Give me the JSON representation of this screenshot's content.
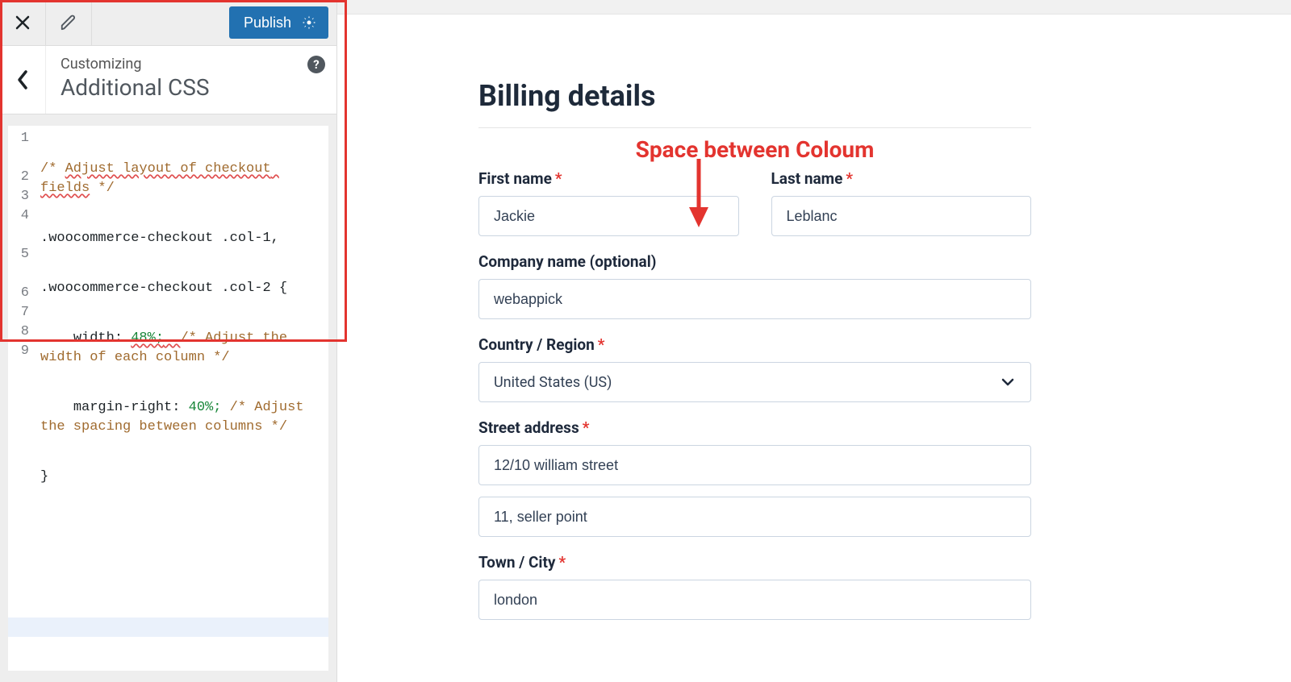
{
  "customizer": {
    "close_title": "Close",
    "brush_title": "Edit",
    "publish_label": "Publish",
    "gear_title": "Publish settings",
    "back_title": "Back",
    "breadcrumb": "Customizing",
    "section_title": "Additional CSS",
    "help_title": "Help"
  },
  "editor": {
    "line_numbers": [
      "1",
      "2",
      "3",
      "4",
      "5",
      "6",
      "7",
      "8",
      "9"
    ],
    "code": {
      "l1a": "/* ",
      "l1b": "Adjust layout of checkout fields",
      "l1c": " */",
      "l2": ".woocommerce-checkout .col-1,",
      "l3": ".woocommerce-checkout .col-2 {",
      "l4_prop": "width: ",
      "l4_val": "48%;",
      "l4_space": "  ",
      "l4_c": "/* Adjust the width of each column */",
      "l5_prop": "margin-right: ",
      "l5_val": "40%;",
      "l5_space": " ",
      "l5_c": "/* Adjust the spacing between columns */",
      "l6": "}"
    }
  },
  "annotation": {
    "callout": "Space between Coloum"
  },
  "billing": {
    "heading": "Billing details",
    "first_name_label": "First name",
    "first_name_value": "Jackie",
    "last_name_label": "Last name",
    "last_name_value": "Leblanc",
    "company_label": "Company name (optional)",
    "company_value": "webappick",
    "country_label": "Country / Region",
    "country_value": "United States (US)",
    "street_label": "Street address",
    "street1_value": "12/10 william street",
    "street2_value": "11, seller point",
    "town_label": "Town / City",
    "town_value": "london"
  }
}
